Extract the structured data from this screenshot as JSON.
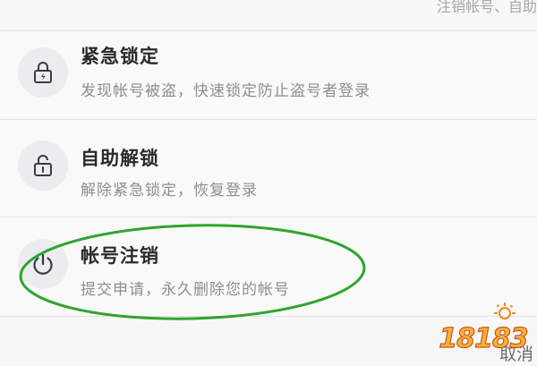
{
  "header": {
    "hint_text": "注销帐号、自助"
  },
  "settings_list": {
    "items": [
      {
        "title": "紧急锁定",
        "description": "发现帐号被盗，快速锁定防止盗号者登录",
        "icon": "emergency-lock-icon"
      },
      {
        "title": "自助解锁",
        "description": "解除紧急锁定，恢复登录",
        "icon": "unlock-icon"
      },
      {
        "title": "帐号注销",
        "description": "提交申请，永久删除您的帐号",
        "icon": "power-icon"
      }
    ]
  },
  "footer": {
    "cancel_label": "取消"
  },
  "annotation": {
    "color": "#2fa52c",
    "shape": "ellipse",
    "target": "帐号注销"
  },
  "watermark": {
    "text": "18183",
    "color": "#f08a1c"
  },
  "colors": {
    "background": "#f7f7f8",
    "title": "#2a2a2d",
    "description": "#8e8e93",
    "icon_bg": "#ececef",
    "icon_stroke": "#3a3a46",
    "divider": "#e2e2e5"
  }
}
